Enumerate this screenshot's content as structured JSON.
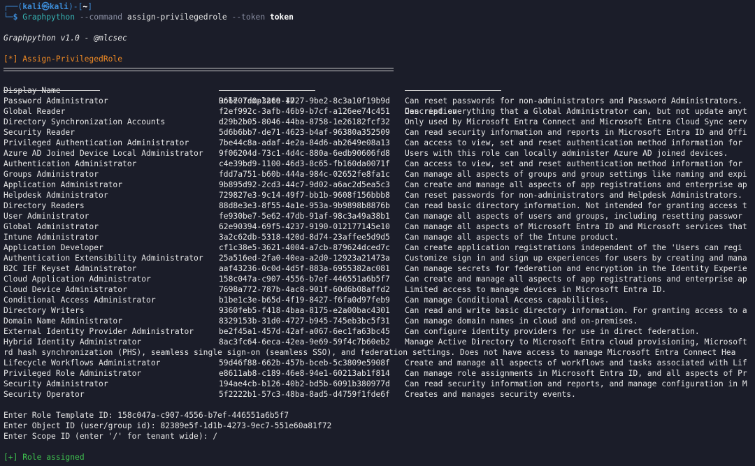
{
  "prompt": {
    "user": "kali",
    "host": "kali",
    "dir": "~",
    "command": "Graphpython",
    "option1": "--command",
    "value1": "assign-privilegedrole",
    "option2": "--token",
    "value2": "token"
  },
  "banner": "Graphpython v1.0 - @mlcsec",
  "section_title": "[*] Assign-PrivilegedRole",
  "table": {
    "headers": [
      "Display Name",
      "Role Template ID",
      "Description"
    ],
    "rows": [
      [
        "Password Administrator",
        "966707d0-3269-4727-9be2-8c3a10f19b9d",
        "Can reset passwords for non-administrators and Password Administrators."
      ],
      [
        "Global Reader",
        "f2ef992c-3afb-46b9-b7cf-a126ee74c451",
        "Can read everything that a Global Administrator can, but not update anyt"
      ],
      [
        "Directory Synchronization Accounts",
        "d29b2b05-8046-44ba-8758-1e26182fcf32",
        "Only used by Microsoft Entra Connect and Microsoft Entra Cloud Sync serv"
      ],
      [
        "Security Reader",
        "5d6b6bb7-de71-4623-b4af-96380a352509",
        "Can read security information and reports in Microsoft Entra ID and Offi"
      ],
      [
        "Privileged Authentication Administrator",
        "7be44c8a-adaf-4e2a-84d6-ab2649e08a13",
        "Can access to view, set and reset authentication method information for"
      ],
      [
        "Azure AD Joined Device Local Administrator",
        "9f06204d-73c1-4d4c-880a-6edb90606fd8",
        "Users with this role can locally administer Azure AD joined devices."
      ],
      [
        "Authentication Administrator",
        "c4e39bd9-1100-46d3-8c65-fb160da0071f",
        "Can access to view, set and reset authentication method information for"
      ],
      [
        "Groups Administrator",
        "fdd7a751-b60b-444a-984c-02652fe8fa1c",
        "Can manage all aspects of groups and group settings like naming and expi"
      ],
      [
        "Application Administrator",
        "9b895d92-2cd3-44c7-9d02-a6ac2d5ea5c3",
        "Can create and manage all aspects of app registrations and enterprise ap"
      ],
      [
        "Helpdesk Administrator",
        "729827e3-9c14-49f7-bb1b-9608f156bbb8",
        "Can reset passwords for non-administrators and Helpdesk Administrators."
      ],
      [
        "Directory Readers",
        "88d8e3e3-8f55-4a1e-953a-9b9898b8876b",
        "Can read basic directory information. Not intended for granting access t"
      ],
      [
        "User Administrator",
        "fe930be7-5e62-47db-91af-98c3a49a38b1",
        "Can manage all aspects of users and groups, including resetting passwor"
      ],
      [
        "Global Administrator",
        "62e90394-69f5-4237-9190-012177145e10",
        "Can manage all aspects of Microsoft Entra ID and Microsoft services that"
      ],
      [
        "Intune Administrator",
        "3a2c62db-5318-420d-8d74-23affee5d9d5",
        "Can manage all aspects of the Intune product."
      ],
      [
        "Application Developer",
        "cf1c38e5-3621-4004-a7cb-879624dced7c",
        "Can create application registrations independent of the 'Users can regi"
      ],
      [
        "Authentication Extensibility Administrator",
        "25a516ed-2fa0-40ea-a2d0-12923a21473a",
        "Customize sign in and sign up experiences for users by creating and mana"
      ],
      [
        "B2C IEF Keyset Administrator",
        "aaf43236-0c0d-4d5f-883a-6955382ac081",
        "Can manage secrets for federation and encryption in the Identity Experie"
      ],
      [
        "Cloud Application Administrator",
        "158c047a-c907-4556-b7ef-446551a6b5f7",
        "Can create and manage all aspects of app registrations and enterprise ap"
      ],
      [
        "Cloud Device Administrator",
        "7698a772-787b-4ac8-901f-60d6b08affd2",
        "Limited access to manage devices in Microsoft Entra ID."
      ],
      [
        "Conditional Access Administrator",
        "b1be1c3e-b65d-4f19-8427-f6fa0d97feb9",
        "Can manage Conditional Access capabilities."
      ],
      [
        "Directory Writers",
        "9360feb5-f418-4baa-8175-e2a00bac4301",
        "Can read and write basic directory information. For granting access to a"
      ],
      [
        "Domain Name Administrator",
        "8329153b-31d0-4727-b945-745eb3bc5f31",
        "Can manage domain names in cloud and on-premises."
      ],
      [
        "External Identity Provider Administrator",
        "be2f45a1-457d-42af-a067-6ec1fa63bc45",
        "Can configure identity providers for use in direct federation."
      ],
      [
        "Hybrid Identity Administrator",
        "8ac3fc64-6eca-42ea-9e69-59f4c7b60eb2",
        "Manage Active Directory to Microsoft Entra cloud provisioning, Microsoft"
      ]
    ],
    "wrap_line": "rd hash synchronization (PHS), seamless single sign-on (seamless SSO), and federation settings. Does not have access to manage Microsoft Entra Connect Hea",
    "rows2": [
      [
        "Lifecycle Workflows Administrator",
        "59d46f88-662b-457b-bceb-5c3809e5908f",
        "Create and manage all aspects of workflows and tasks associated with Lif"
      ],
      [
        "Privileged Role Administrator",
        "e8611ab8-c189-46e8-94e1-60213ab1f814",
        "Can manage role assignments in Microsoft Entra ID, and all aspects of Pr"
      ],
      [
        "Security Administrator",
        "194ae4cb-b126-40b2-bd5b-6091b380977d",
        "Can read security information and reports, and manage configuration in M"
      ],
      [
        "Security Operator",
        "5f2222b1-57c3-48ba-8ad5-d4759f1fde6f",
        "Creates and manages security events."
      ]
    ]
  },
  "inputs": {
    "role_prompt": "Enter Role Template ID: ",
    "role_value": "158c047a-c907-4556-b7ef-446551a6b5f7",
    "object_prompt": "Enter Object ID (user/group id): ",
    "object_value": "82389e5f-1d1b-4273-9ec7-551e60a81f72",
    "scope_prompt": "Enter Scope ID (enter '/' for tenant wide): ",
    "scope_value": "/"
  },
  "result": "[+] Role assigned",
  "colors": {
    "background": "#1b1d29",
    "prompt_blue": "#3c8bd6",
    "command_cyan": "#36b3b3",
    "info_orange": "#f08a24",
    "success_green": "#3fc34f"
  }
}
